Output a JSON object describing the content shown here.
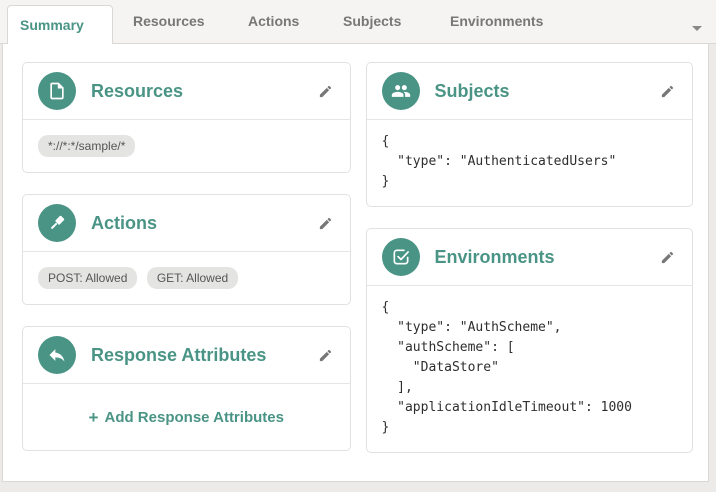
{
  "tabs": {
    "items": [
      {
        "label": "Summary",
        "active": true
      },
      {
        "label": "Resources",
        "active": false
      },
      {
        "label": "Actions",
        "active": false
      },
      {
        "label": "Subjects",
        "active": false
      },
      {
        "label": "Environments",
        "active": false
      }
    ],
    "overflow_icon": "caret-down-icon"
  },
  "colors": {
    "accent_teal": "#4a9486",
    "tab_inactive_text": "#777777",
    "tab_strip_bg": "#f5f4f2",
    "card_border": "#e2e1df",
    "badge_bg": "#e4e4e2",
    "json_text": "#2e2e2e"
  },
  "cards": {
    "resources": {
      "title": "Resources",
      "icon": "file-icon",
      "badges": [
        "*://*:*/sample/*"
      ]
    },
    "actions": {
      "title": "Actions",
      "icon": "gavel-icon",
      "badges": [
        "POST: Allowed",
        "GET: Allowed"
      ]
    },
    "response_attributes": {
      "title": "Response Attributes",
      "icon": "reply-arrow-icon",
      "plus_icon": "+",
      "add_label": "Add Response Attributes"
    },
    "subjects": {
      "title": "Subjects",
      "icon": "users-icon",
      "json": "{\n  \"type\": \"AuthenticatedUsers\"\n}"
    },
    "environments": {
      "title": "Environments",
      "icon": "check-square-icon",
      "json": "{\n  \"type\": \"AuthScheme\",\n  \"authScheme\": [\n    \"DataStore\"\n  ],\n  \"applicationIdleTimeout\": 1000\n}"
    }
  }
}
